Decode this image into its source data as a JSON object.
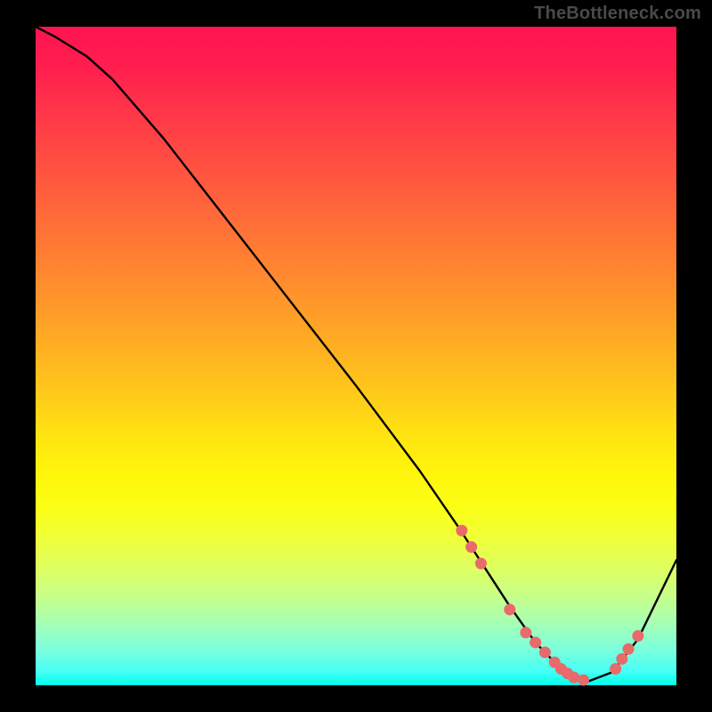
{
  "watermark": "TheBottleneck.com",
  "chart_data": {
    "type": "line",
    "title": "",
    "xlabel": "",
    "ylabel": "",
    "xlim": [
      0,
      100
    ],
    "ylim": [
      0,
      100
    ],
    "series": [
      {
        "name": "curve",
        "x": [
          0,
          3,
          8,
          12,
          20,
          30,
          40,
          50,
          60,
          66,
          70,
          74,
          78,
          82,
          86,
          90,
          94,
          100
        ],
        "y": [
          100,
          98.5,
          95.5,
          92,
          83,
          70.5,
          58,
          45.5,
          32.5,
          24,
          18,
          12,
          6.5,
          2.5,
          0.5,
          2,
          7,
          19
        ]
      }
    ],
    "points": {
      "name": "markers",
      "color": "#e86a6a",
      "x": [
        66.5,
        68,
        69.5,
        74,
        76.5,
        78,
        79.5,
        81,
        82,
        83,
        84,
        85.5,
        90.5,
        91.5,
        92.5,
        94
      ],
      "y": [
        23.5,
        21,
        18.5,
        11.5,
        8,
        6.5,
        5,
        3.5,
        2.5,
        1.8,
        1.2,
        0.8,
        2.5,
        4,
        5.5,
        7.5
      ]
    },
    "gradient_stops": [
      {
        "pos": 0.0,
        "color": "#ff1451"
      },
      {
        "pos": 0.5,
        "color": "#ffd018"
      },
      {
        "pos": 0.8,
        "color": "#efff3a"
      },
      {
        "pos": 1.0,
        "color": "#00ffea"
      }
    ]
  }
}
